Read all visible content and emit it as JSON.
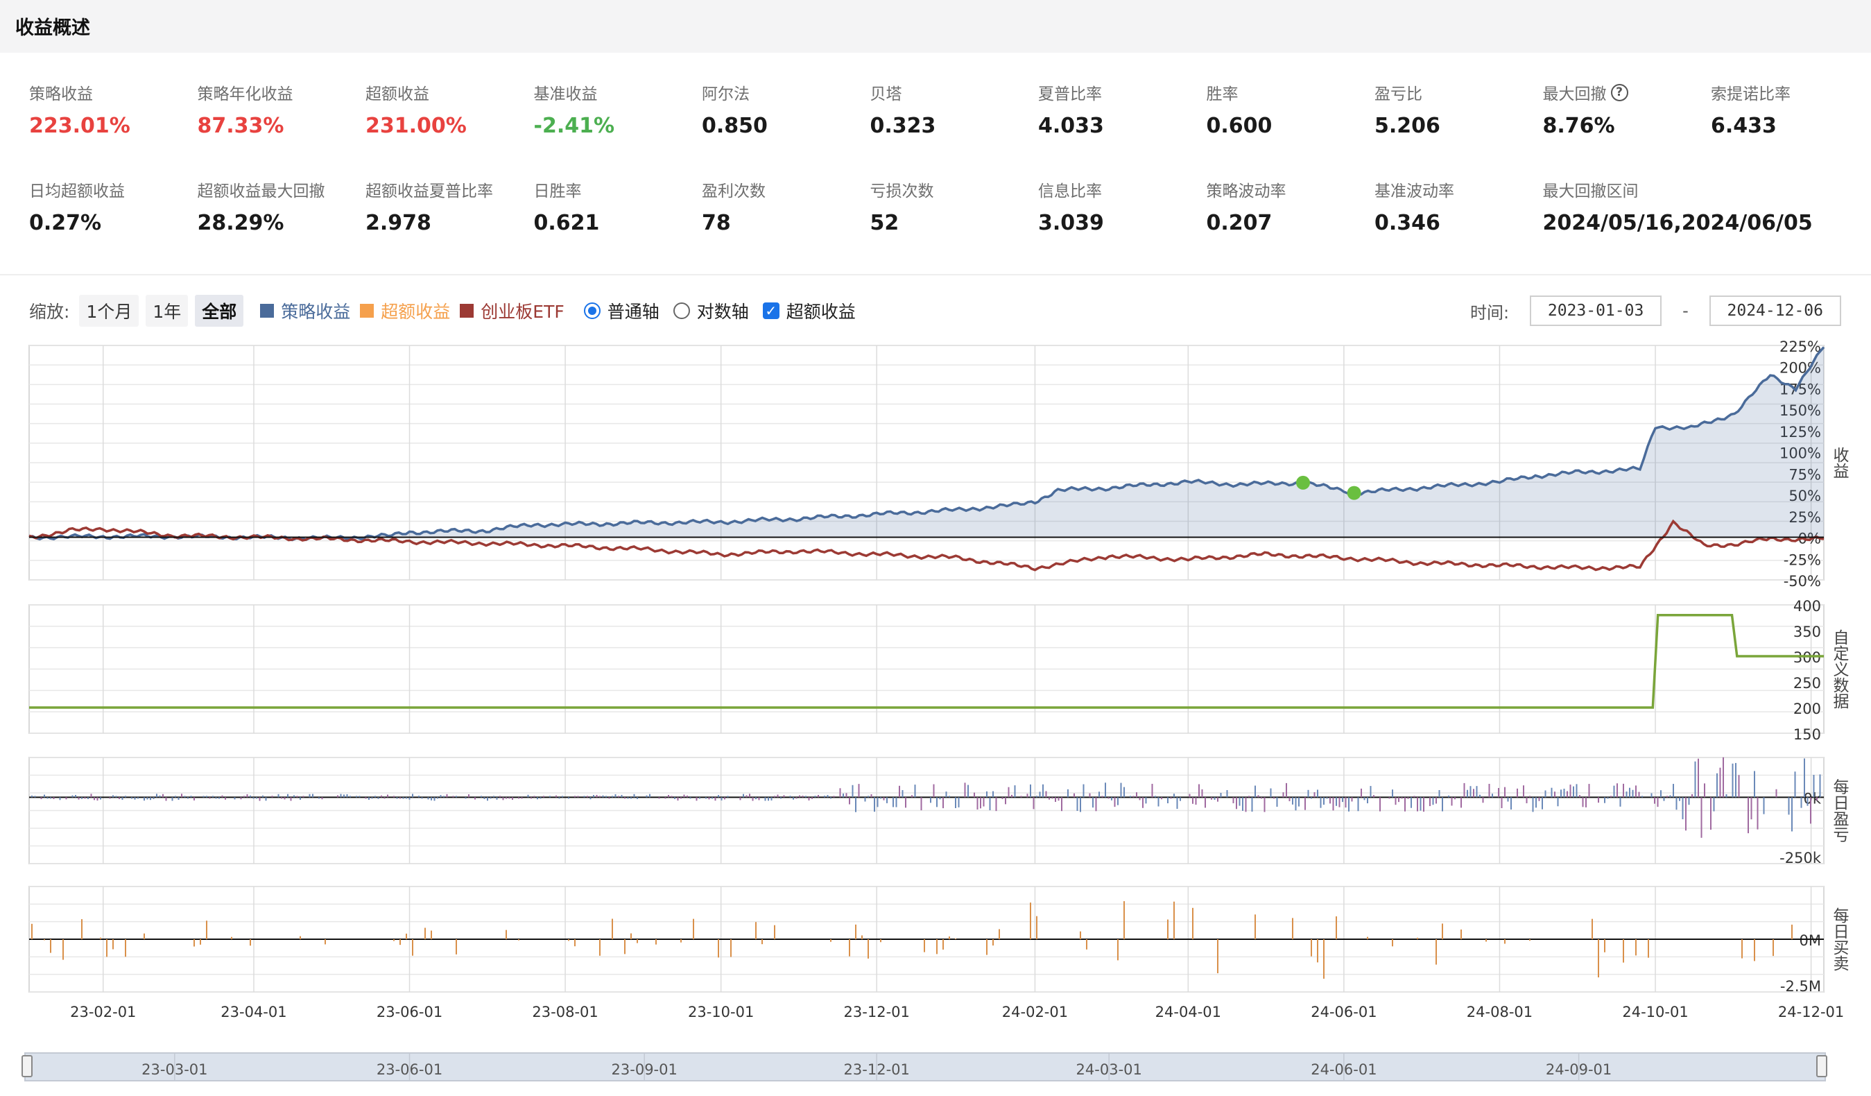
{
  "header": {
    "title": "收益概述"
  },
  "metrics_row1": [
    {
      "label": "策略收益",
      "value": "223.01%",
      "color": "red"
    },
    {
      "label": "策略年化收益",
      "value": "87.33%",
      "color": "red"
    },
    {
      "label": "超额收益",
      "value": "231.00%",
      "color": "red"
    },
    {
      "label": "基准收益",
      "value": "-2.41%",
      "color": "green"
    },
    {
      "label": "阿尔法",
      "value": "0.850",
      "color": ""
    },
    {
      "label": "贝塔",
      "value": "0.323",
      "color": ""
    },
    {
      "label": "夏普比率",
      "value": "4.033",
      "color": ""
    },
    {
      "label": "胜率",
      "value": "0.600",
      "color": ""
    },
    {
      "label": "盈亏比",
      "value": "5.206",
      "color": ""
    },
    {
      "label": "最大回撤",
      "value": "8.76%",
      "color": "",
      "help": true
    },
    {
      "label": "索提诺比率",
      "value": "6.433",
      "color": ""
    }
  ],
  "metrics_row2": [
    {
      "label": "日均超额收益",
      "value": "0.27%"
    },
    {
      "label": "超额收益最大回撤",
      "value": "28.29%"
    },
    {
      "label": "超额收益夏普比率",
      "value": "2.978"
    },
    {
      "label": "日胜率",
      "value": "0.621"
    },
    {
      "label": "盈利次数",
      "value": "78"
    },
    {
      "label": "亏损次数",
      "value": "52"
    },
    {
      "label": "信息比率",
      "value": "3.039"
    },
    {
      "label": "策略波动率",
      "value": "0.207"
    },
    {
      "label": "基准波动率",
      "value": "0.346"
    },
    {
      "label": "最大回撤区间",
      "value": "2024/05/16,2024/06/05"
    }
  ],
  "toolbar": {
    "zoom_label": "缩放:",
    "zoom_buttons": [
      "1个月",
      "1年",
      "全部"
    ],
    "zoom_active": "全部",
    "legend": [
      {
        "name": "策略收益",
        "color": "#4a6b9a"
      },
      {
        "name": "超额收益",
        "color": "#f5a04c"
      },
      {
        "name": "创业板ETF",
        "color": "#9c3a34"
      }
    ],
    "axis_normal": "普通轴",
    "axis_log": "对数轴",
    "excess_checkbox": "超额收益",
    "time_label": "时间:",
    "start_date": "2023-01-03",
    "end_date": "2024-12-06",
    "dash": "-"
  },
  "chart_data": [
    {
      "type": "area",
      "panel": "收益",
      "y_ticks": [
        "225%",
        "200%",
        "175%",
        "150%",
        "125%",
        "100%",
        "75%",
        "50%",
        "25%",
        "0%",
        "-25%",
        "-50%"
      ],
      "ylim": [
        -50,
        225
      ],
      "series": [
        {
          "name": "策略收益",
          "color": "#4a6b9a",
          "points": [
            [
              "2023-01-03",
              0
            ],
            [
              "2023-02-01",
              1
            ],
            [
              "2023-03-01",
              1
            ],
            [
              "2023-04-01",
              0
            ],
            [
              "2023-05-01",
              -1
            ],
            [
              "2023-05-25",
              2
            ],
            [
              "2023-06-01",
              6
            ],
            [
              "2023-07-01",
              8
            ],
            [
              "2023-07-20",
              15
            ],
            [
              "2023-08-01",
              15
            ],
            [
              "2023-09-01",
              17
            ],
            [
              "2023-10-01",
              18
            ],
            [
              "2023-11-01",
              22
            ],
            [
              "2023-12-01",
              27
            ],
            [
              "2024-01-01",
              32
            ],
            [
              "2024-01-25",
              38
            ],
            [
              "2024-02-01",
              42
            ],
            [
              "2024-02-10",
              55
            ],
            [
              "2024-03-01",
              58
            ],
            [
              "2024-04-01",
              65
            ],
            [
              "2024-04-20",
              62
            ],
            [
              "2024-05-16",
              64
            ],
            [
              "2024-06-01",
              55
            ],
            [
              "2024-06-05",
              52
            ],
            [
              "2024-07-01",
              58
            ],
            [
              "2024-08-01",
              65
            ],
            [
              "2024-08-15",
              72
            ],
            [
              "2024-09-01",
              76
            ],
            [
              "2024-09-25",
              80
            ],
            [
              "2024-10-01",
              130
            ],
            [
              "2024-10-15",
              128
            ],
            [
              "2024-11-01",
              145
            ],
            [
              "2024-11-15",
              190
            ],
            [
              "2024-11-25",
              175
            ],
            [
              "2024-12-06",
              223
            ]
          ]
        },
        {
          "name": "创业板ETF",
          "color": "#9c3a34",
          "points": [
            [
              "2023-01-03",
              0
            ],
            [
              "2023-01-20",
              8
            ],
            [
              "2023-02-01",
              10
            ],
            [
              "2023-03-01",
              2
            ],
            [
              "2023-04-01",
              0
            ],
            [
              "2023-05-01",
              -2
            ],
            [
              "2023-06-01",
              -5
            ],
            [
              "2023-07-01",
              -7
            ],
            [
              "2023-08-01",
              -10
            ],
            [
              "2023-09-01",
              -14
            ],
            [
              "2023-10-01",
              -20
            ],
            [
              "2023-11-01",
              -16
            ],
            [
              "2023-12-01",
              -20
            ],
            [
              "2024-01-01",
              -24
            ],
            [
              "2024-02-01",
              -36
            ],
            [
              "2024-03-01",
              -22
            ],
            [
              "2024-04-01",
              -26
            ],
            [
              "2024-05-01",
              -20
            ],
            [
              "2024-06-01",
              -24
            ],
            [
              "2024-07-01",
              -30
            ],
            [
              "2024-08-01",
              -33
            ],
            [
              "2024-09-01",
              -36
            ],
            [
              "2024-09-25",
              -35
            ],
            [
              "2024-10-08",
              18
            ],
            [
              "2024-10-20",
              -10
            ],
            [
              "2024-11-01",
              -8
            ],
            [
              "2024-11-15",
              -2
            ],
            [
              "2024-12-06",
              -2
            ]
          ]
        }
      ],
      "markers": [
        {
          "x": "2024-05-16",
          "y": 64,
          "color": "#6abf40"
        },
        {
          "x": "2024-06-05",
          "y": 52,
          "color": "#6abf40"
        }
      ]
    },
    {
      "type": "line",
      "panel": "自定义数据",
      "y_ticks": [
        "400",
        "350",
        "300",
        "250",
        "200",
        "150"
      ],
      "ylim": [
        150,
        400
      ],
      "series": [
        {
          "name": "",
          "color": "#7aa53a",
          "points": [
            [
              "2023-01-03",
              200
            ],
            [
              "2024-09-30",
              200
            ],
            [
              "2024-10-02",
              380
            ],
            [
              "2024-10-31",
              380
            ],
            [
              "2024-11-02",
              300
            ],
            [
              "2024-12-06",
              300
            ]
          ]
        }
      ]
    },
    {
      "type": "bar",
      "panel": "每日盈亏",
      "y_ticks": [
        "0k",
        "-250k"
      ],
      "ylim": [
        -250,
        150
      ],
      "color": "#6a89b8"
    },
    {
      "type": "bar",
      "panel": "每日买卖",
      "y_ticks": [
        "0M",
        "-2.5M"
      ],
      "ylim": [
        -2.5,
        2.5
      ],
      "color": "#e0a060"
    }
  ],
  "x_ticks": [
    "23-02-01",
    "23-04-01",
    "23-06-01",
    "23-08-01",
    "23-10-01",
    "23-12-01",
    "24-02-01",
    "24-04-01",
    "24-06-01",
    "24-08-01",
    "24-10-01",
    "24-12-01"
  ],
  "navigator_ticks": [
    "23-03-01",
    "23-06-01",
    "23-09-01",
    "23-12-01",
    "24-03-01",
    "24-06-01",
    "24-09-01"
  ],
  "side_labels": {
    "p1": "收益",
    "p2": "自定义数据",
    "p3": "每日盈亏",
    "p4": "每日买卖"
  }
}
